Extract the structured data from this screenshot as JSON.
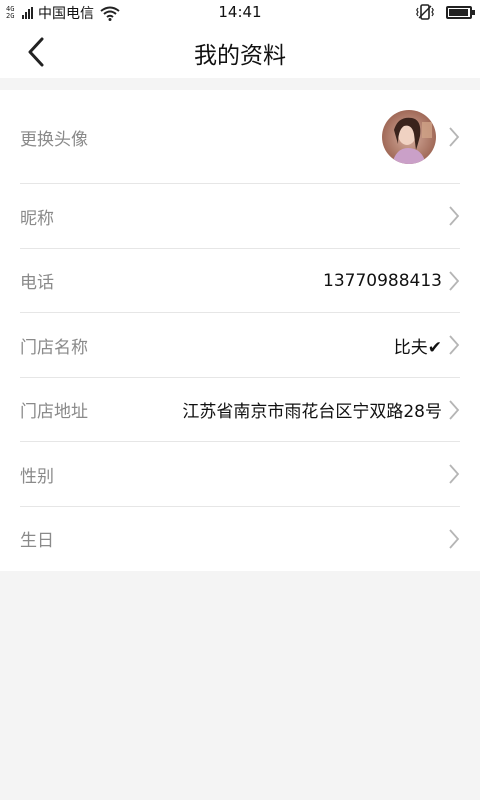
{
  "status_bar": {
    "network_top": "4G",
    "network_bottom": "2G",
    "carrier": "中国电信",
    "time": "14:41",
    "battery_level": 0.85
  },
  "header": {
    "title": "我的资料",
    "back_icon": "chevron-left-icon"
  },
  "profile": {
    "rows": [
      {
        "label": "更换头像",
        "value": "",
        "type": "avatar"
      },
      {
        "label": "昵称",
        "value": ""
      },
      {
        "label": "电话",
        "value": "13770988413"
      },
      {
        "label": "门店名称",
        "value": "比夫✔"
      },
      {
        "label": "门店地址",
        "value": "江苏省南京市雨花台区宁双路28号"
      },
      {
        "label": "性别",
        "value": ""
      },
      {
        "label": "生日",
        "value": ""
      }
    ]
  },
  "colors": {
    "background": "#f4f4f4",
    "card": "#ffffff",
    "label": "#8a8a8a",
    "value": "#111111",
    "chevron": "#b5b5b5"
  }
}
